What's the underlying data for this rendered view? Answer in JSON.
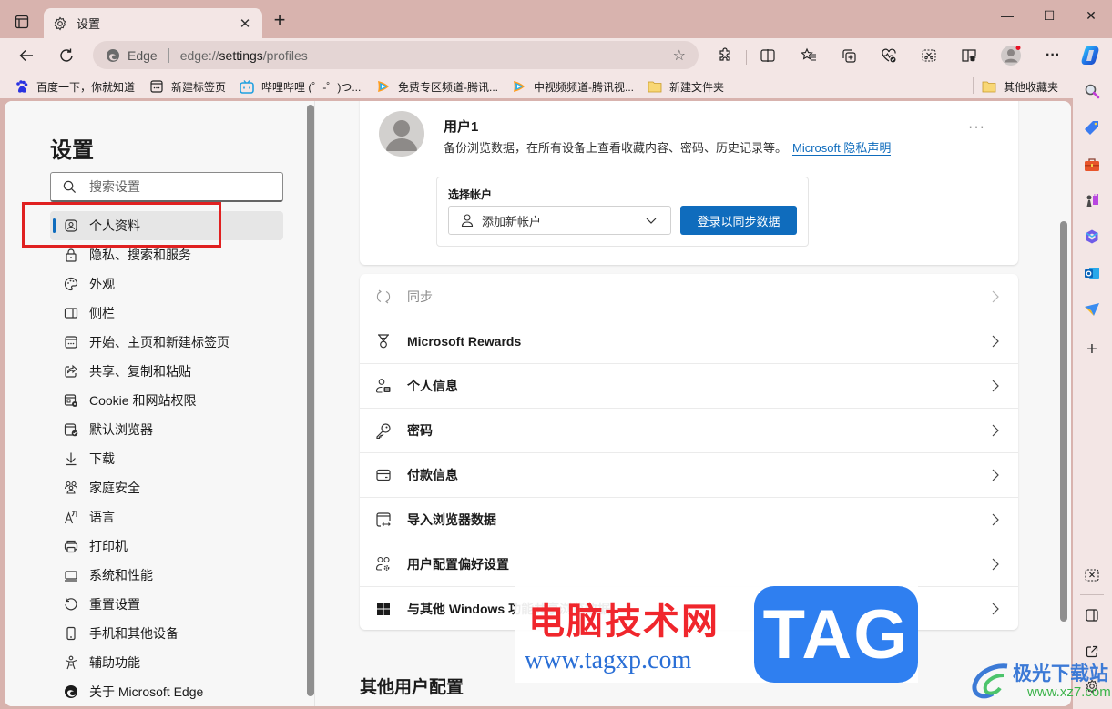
{
  "window": {
    "tab_title": "设置",
    "new_tab_symbol": "+",
    "minimize_symbol": "—",
    "maximize_symbol": "☐",
    "close_symbol": "✕",
    "tab_close_symbol": "✕"
  },
  "toolbar": {
    "site_label": "Edge",
    "url_prefix": "edge://",
    "url_host": "settings",
    "url_path": "/profiles",
    "icons": [
      "back-icon",
      "refresh-icon",
      "favorite-star-icon",
      "extensions-icon",
      "split-screen-icon",
      "favorites-icon",
      "collections-icon",
      "browser-essentials-icon",
      "screenshot-icon",
      "education-icon",
      "profile-icon",
      "more-icon",
      "copilot-icon"
    ],
    "more_label": "···"
  },
  "favorites": [
    {
      "label": "百度一下，你就知道",
      "icon": "baidu-icon"
    },
    {
      "label": "新建标签页",
      "icon": "new-tab-page-icon"
    },
    {
      "label": "哔哩哔哩 (゜-゜)つ...",
      "icon": "bilibili-icon"
    },
    {
      "label": "免费专区频道-腾讯...",
      "icon": "tencent-video-icon"
    },
    {
      "label": "中视频频道-腾讯视...",
      "icon": "tencent-video-icon"
    },
    {
      "label": "新建文件夹",
      "icon": "folder-icon"
    },
    {
      "label": "其他收藏夹",
      "icon": "folder-icon"
    }
  ],
  "right_sidebar": [
    "search-icon",
    "shopping-tag-icon",
    "tools-icon",
    "games-icon",
    "microsoft365-icon",
    "outlook-icon",
    "send-icon",
    "add-icon",
    "screenshot-icon",
    "sidebar-toggle-icon",
    "open-external-icon",
    "settings-icon"
  ],
  "settings": {
    "title": "设置",
    "search_placeholder": "搜索设置",
    "nav": [
      {
        "label": "个人资料",
        "icon": "profile-icon",
        "active": true
      },
      {
        "label": "隐私、搜索和服务",
        "icon": "lock-icon"
      },
      {
        "label": "外观",
        "icon": "palette-icon"
      },
      {
        "label": "侧栏",
        "icon": "sidebar-icon"
      },
      {
        "label": "开始、主页和新建标签页",
        "icon": "home-tab-icon"
      },
      {
        "label": "共享、复制和粘贴",
        "icon": "share-icon"
      },
      {
        "label": "Cookie 和网站权限",
        "icon": "cookie-icon"
      },
      {
        "label": "默认浏览器",
        "icon": "default-browser-icon"
      },
      {
        "label": "下载",
        "icon": "download-icon"
      },
      {
        "label": "家庭安全",
        "icon": "family-icon"
      },
      {
        "label": "语言",
        "icon": "language-icon"
      },
      {
        "label": "打印机",
        "icon": "printer-icon"
      },
      {
        "label": "系统和性能",
        "icon": "laptop-icon"
      },
      {
        "label": "重置设置",
        "icon": "reset-icon"
      },
      {
        "label": "手机和其他设备",
        "icon": "phone-icon"
      },
      {
        "label": "辅助功能",
        "icon": "accessibility-icon"
      },
      {
        "label": "关于 Microsoft Edge",
        "icon": "edge-logo-icon"
      }
    ]
  },
  "profile": {
    "name": "用户1",
    "description": "备份浏览数据，在所有设备上查看收藏内容、密码、历史记录等。",
    "privacy_link": "Microsoft 隐私声明",
    "more_label": "···",
    "account_label": "选择帐户",
    "account_select_value": "添加新帐户",
    "signin_button": "登录以同步数据"
  },
  "profile_rows": [
    {
      "label": "同步",
      "icon": "sync-icon",
      "disabled": true
    },
    {
      "label": "Microsoft Rewards",
      "icon": "rewards-icon"
    },
    {
      "label": "个人信息",
      "icon": "personal-info-icon"
    },
    {
      "label": "密码",
      "icon": "key-icon"
    },
    {
      "label": "付款信息",
      "icon": "card-icon"
    },
    {
      "label": "导入浏览器数据",
      "icon": "import-icon"
    },
    {
      "label": "用户配置偏好设置",
      "icon": "profile-preferences-icon"
    },
    {
      "label": "与其他 Windows 功能共享浏览数据",
      "icon": "windows-icon"
    }
  ],
  "other_profiles_heading": "其他用户配置",
  "watermarks": {
    "tagxp_cn": "电脑技术网",
    "tagxp_url": "www.tagxp.com",
    "tagxp_logo": "TAG",
    "xz7_cn": "极光下载站",
    "xz7_url": "www.xz7.com"
  },
  "colors": {
    "accent": "#0f6cbd",
    "frame": "#d8b3ae",
    "toolbar": "#f3e6e5",
    "highlight_box": "#e02020"
  }
}
